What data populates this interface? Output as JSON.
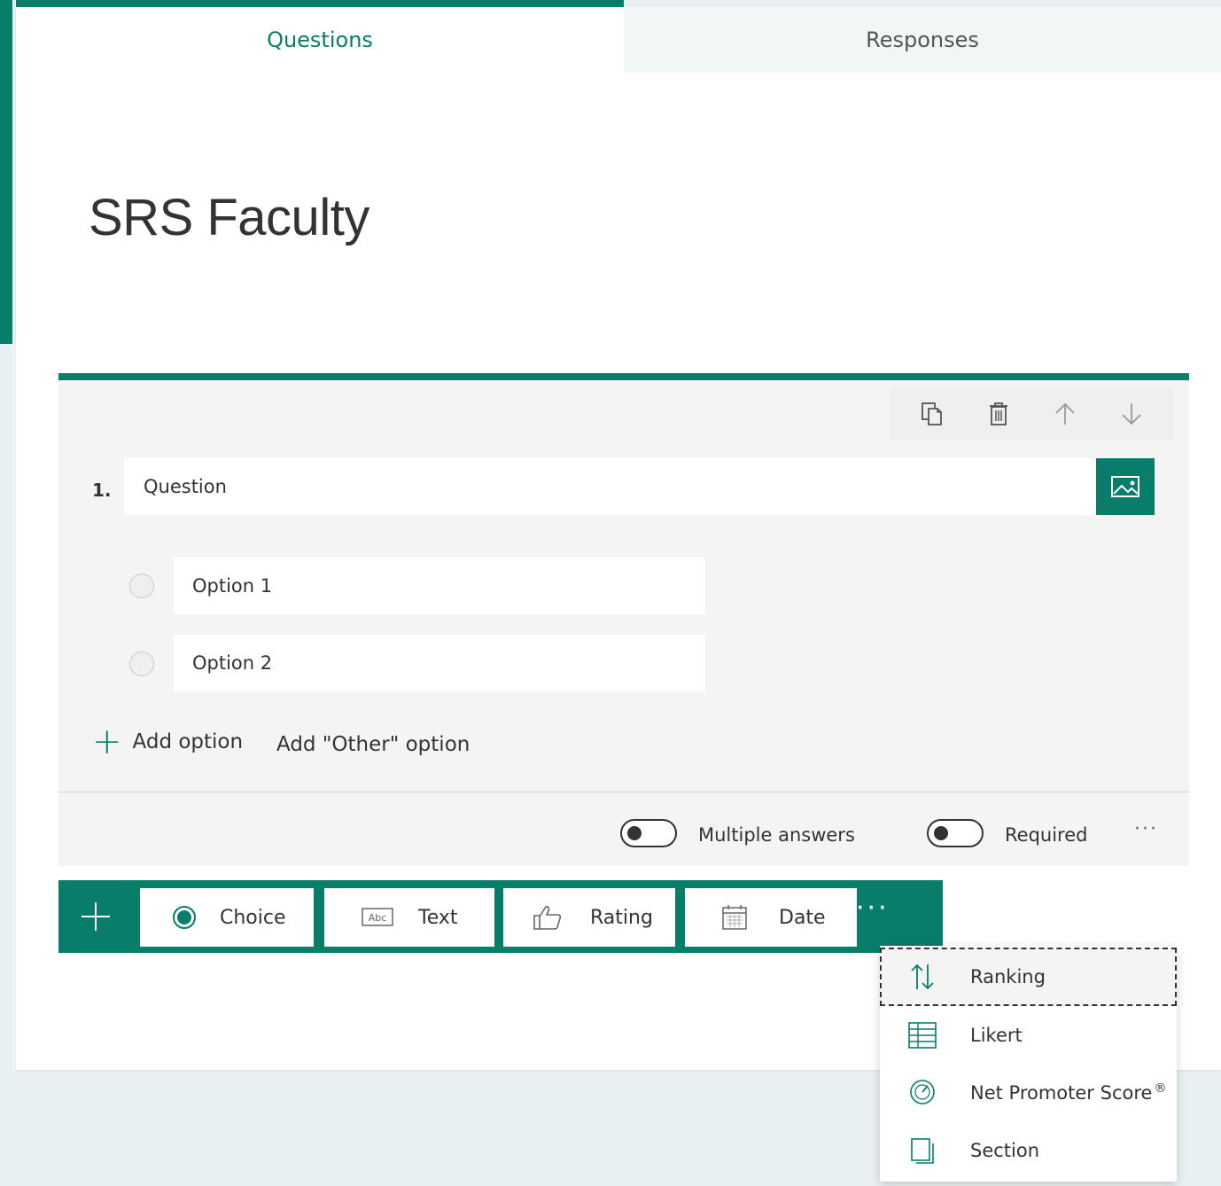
{
  "tabs": {
    "questions": "Questions",
    "responses": "Responses"
  },
  "form": {
    "title": "SRS Faculty"
  },
  "question": {
    "number": "1.",
    "text": "Question",
    "options": [
      "Option 1",
      "Option 2"
    ],
    "add_option": "Add option",
    "add_other": "Add \"Other\" option",
    "multiple_answers": "Multiple answers",
    "required": "Required",
    "more": "···"
  },
  "question_types": {
    "choice": "Choice",
    "text": "Text",
    "rating": "Rating",
    "date": "Date",
    "more": "···"
  },
  "more_menu": {
    "ranking": "Ranking",
    "likert": "Likert",
    "nps": "Net Promoter Score",
    "nps_mark": "®",
    "section": "Section"
  },
  "colors": {
    "accent": "#077d6a",
    "card_bg": "#f4f4f4",
    "page_bg": "#e8f0f2"
  },
  "icons": {
    "copy": "copy-icon",
    "delete": "trash-icon",
    "move_up": "arrow-up-icon",
    "move_down": "arrow-down-icon",
    "image": "image-icon",
    "add": "plus-icon"
  }
}
